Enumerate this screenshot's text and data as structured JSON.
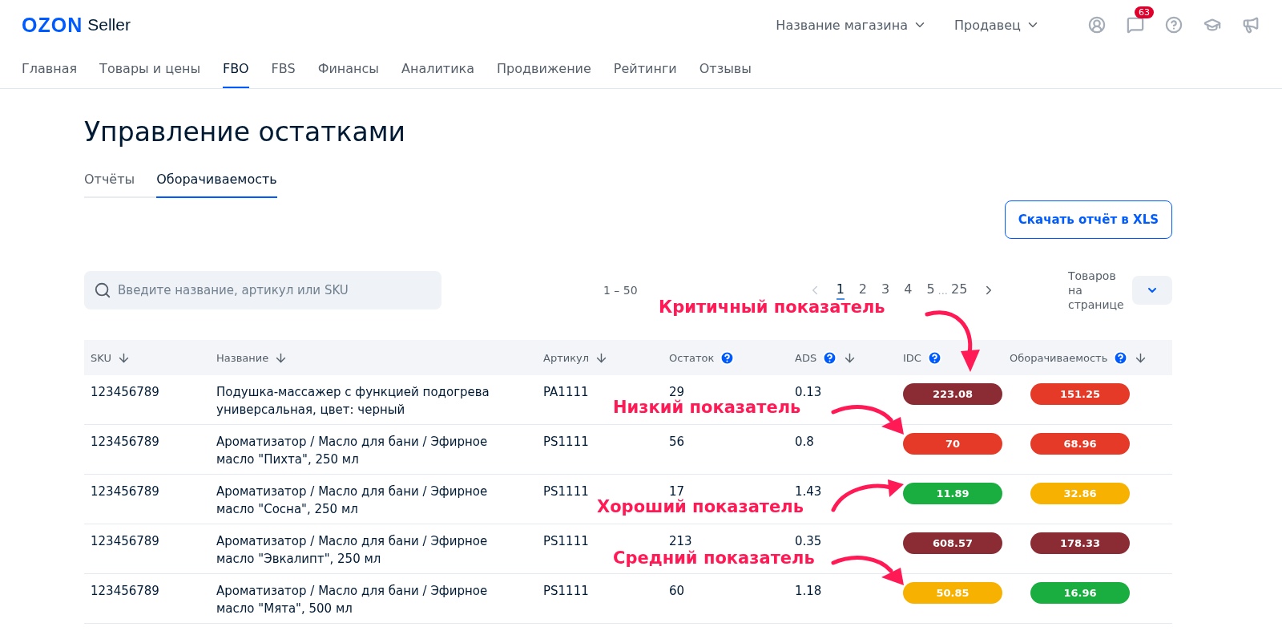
{
  "header": {
    "logo": "OZON",
    "logo_suffix": "Seller",
    "store": "Название магазина",
    "role": "Продавец",
    "chat_badge": "63"
  },
  "nav": [
    {
      "label": "Главная",
      "selected": false
    },
    {
      "label": "Товары и цены",
      "selected": false
    },
    {
      "label": "FBO",
      "selected": true
    },
    {
      "label": "FBS",
      "selected": false
    },
    {
      "label": "Финансы",
      "selected": false
    },
    {
      "label": "Аналитика",
      "selected": false
    },
    {
      "label": "Продвижение",
      "selected": false
    },
    {
      "label": "Рейтинги",
      "selected": false
    },
    {
      "label": "Отзывы",
      "selected": false
    }
  ],
  "title": "Управление остатками",
  "tabs": [
    {
      "label": "Отчёты",
      "selected": false
    },
    {
      "label": "Оборачиваемость",
      "selected": true
    }
  ],
  "download_button": "Скачать отчёт в XLS",
  "search": {
    "placeholder": "Введите название, артикул или SKU"
  },
  "range": "1 – 50",
  "pagination": {
    "pages": [
      {
        "label": "1",
        "selected": true
      },
      {
        "label": "2",
        "selected": false
      },
      {
        "label": "3",
        "selected": false
      },
      {
        "label": "4",
        "selected": false
      },
      {
        "label": "5",
        "selected": false
      }
    ],
    "ellipsis": "...",
    "last": "25",
    "prev_disabled": true
  },
  "per_page_label": "Товаров на странице",
  "table": {
    "columns": [
      {
        "label": "SKU",
        "help": false,
        "sort": true
      },
      {
        "label": "Название",
        "help": false,
        "sort": true
      },
      {
        "label": "Артикул",
        "help": false,
        "sort": true
      },
      {
        "label": "Остаток",
        "help": true,
        "sort": false
      },
      {
        "label": "ADS",
        "help": true,
        "sort": true
      },
      {
        "label": "IDC",
        "help": true,
        "sort": false
      },
      {
        "label": "Оборачиваемость",
        "help": true,
        "sort": true
      }
    ],
    "rows": [
      {
        "sku": "123456789",
        "name": "Подушка-массажер с функцией подогрева универсальная, цвет: черный",
        "article": "PA1111",
        "stock": "29",
        "ads": "0.13",
        "idc": {
          "value": "223.08",
          "color": "#8b2c35"
        },
        "turnover": {
          "value": "151.25",
          "color": "#e63a28"
        }
      },
      {
        "sku": "123456789",
        "name": "Ароматизатор / Масло для бани / Эфирное масло \"Пихта\", 250 мл",
        "article": "PS1111",
        "stock": "56",
        "ads": "0.8",
        "idc": {
          "value": "70",
          "color": "#e63a28"
        },
        "turnover": {
          "value": "68.96",
          "color": "#e63a28"
        }
      },
      {
        "sku": "123456789",
        "name": "Ароматизатор / Масло для бани / Эфирное масло \"Сосна\", 250 мл",
        "article": "PS1111",
        "stock": "17",
        "ads": "1.43",
        "idc": {
          "value": "11.89",
          "color": "#1aae40"
        },
        "turnover": {
          "value": "32.86",
          "color": "#f7b100"
        }
      },
      {
        "sku": "123456789",
        "name": "Ароматизатор / Масло для бани / Эфирное масло \"Эвкалипт\", 250 мл",
        "article": "PS1111",
        "stock": "213",
        "ads": "0.35",
        "idc": {
          "value": "608.57",
          "color": "#8b2c35"
        },
        "turnover": {
          "value": "178.33",
          "color": "#8b2c35"
        }
      },
      {
        "sku": "123456789",
        "name": "Ароматизатор / Масло для бани / Эфирное масло \"Мята\", 500 мл",
        "article": "PS1111",
        "stock": "60",
        "ads": "1.18",
        "idc": {
          "value": "50.85",
          "color": "#f7b100"
        },
        "turnover": {
          "value": "16.96",
          "color": "#1aae40"
        }
      }
    ]
  },
  "annotations": [
    {
      "text": "Критичный показатель"
    },
    {
      "text": "Низкий показатель"
    },
    {
      "text": "Хороший показатель"
    },
    {
      "text": "Средний показатель"
    }
  ]
}
